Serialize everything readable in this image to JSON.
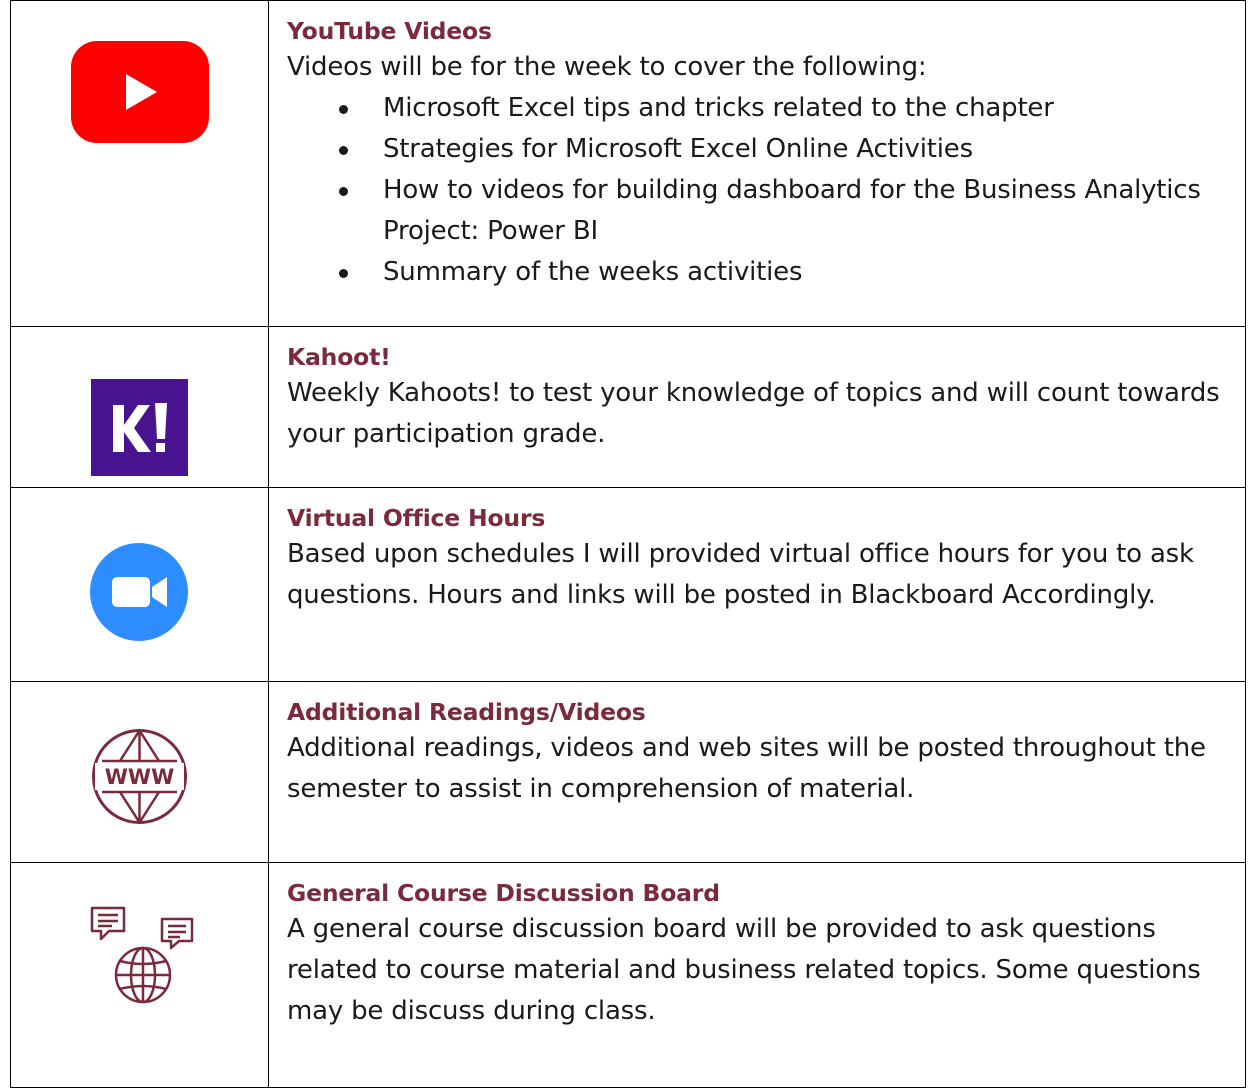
{
  "rows": [
    {
      "icon": "youtube-icon",
      "heading": "YouTube Videos",
      "intro": "Videos will be for the week to cover the following:",
      "bullets": [
        "Microsoft Excel tips and tricks related to the chapter",
        "Strategies for Microsoft Excel Online Activities",
        "How to videos for building dashboard for the Business Analytics Project: Power BI",
        "Summary of the weeks activities"
      ]
    },
    {
      "icon": "kahoot-icon",
      "heading": "Kahoot!",
      "body": "Weekly Kahoots!  to test your knowledge of topics and will count towards your participation grade."
    },
    {
      "icon": "zoom-video-icon",
      "heading": "Virtual Office Hours",
      "body": "Based upon schedules I will provided virtual office hours for you to ask questions.  Hours and links will be posted in Blackboard Accordingly."
    },
    {
      "icon": "www-globe-icon",
      "icon_text": "WWW",
      "heading": "Additional Readings/Videos",
      "body": "Additional readings, videos and web sites will be posted throughout the semester to assist in comprehension of material."
    },
    {
      "icon": "discussion-globe-icon",
      "heading": "General Course Discussion Board",
      "body": "A general course discussion board will be provided to ask questions related to course material and business related topics.  Some questions may be discuss during class."
    }
  ],
  "colors": {
    "heading": "#7a2a3c",
    "youtube_red": "#ff0000",
    "kahoot_purple": "#47138f",
    "zoom_blue": "#2d8cff",
    "icon_maroon": "#7a2a3c"
  },
  "kahoot_logo_text": "K!"
}
